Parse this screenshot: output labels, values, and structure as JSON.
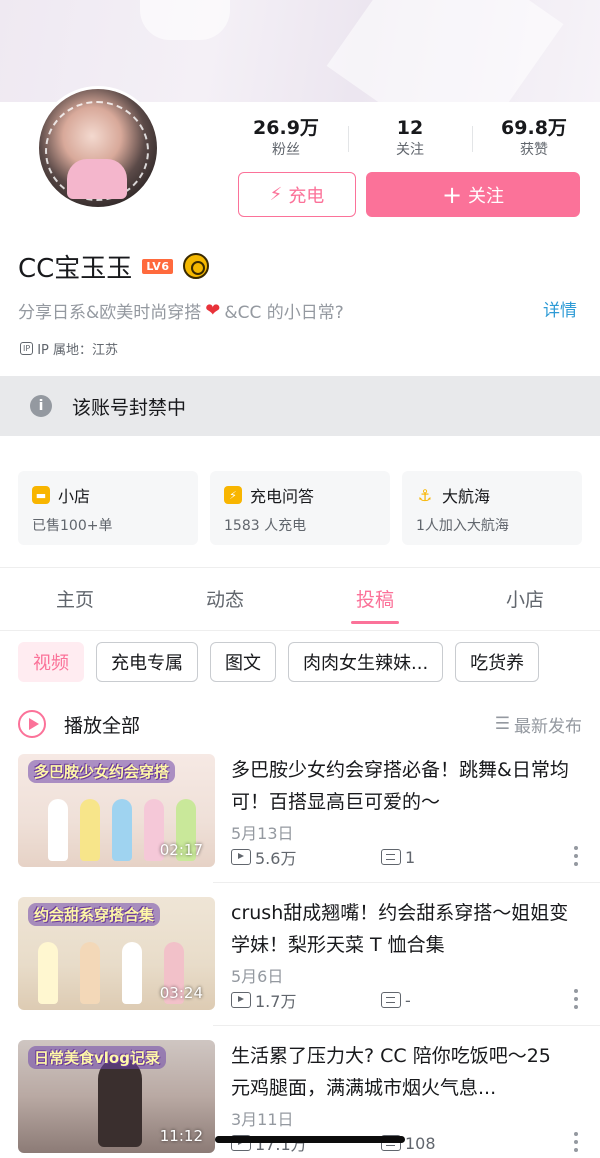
{
  "profile": {
    "name": "CC宝玉玉",
    "level": "LV6",
    "bio_prefix": "分享日系&欧美时尚穿搭",
    "bio_suffix": "&CC 的小日常?",
    "heart": "❤",
    "detail_link": "详情",
    "ip_label": "IP",
    "ip_text": "IP 属地：江苏"
  },
  "stats": [
    {
      "value": "26.9万",
      "label": "粉丝"
    },
    {
      "value": "12",
      "label": "关注"
    },
    {
      "value": "69.8万",
      "label": "获赞"
    }
  ],
  "actions": {
    "charge_label": "充电",
    "charge_icon": "⚡",
    "follow_label": "关注",
    "follow_icon": "+"
  },
  "notice": {
    "icon": "i",
    "text": "该账号封禁中"
  },
  "cards": [
    {
      "title": "小店",
      "sub": "已售100+单",
      "icon": "shop-icon",
      "color": "#f8b500"
    },
    {
      "title": "充电问答",
      "sub": "1583 人充电",
      "icon": "lightning-icon",
      "color": "#f8b500"
    },
    {
      "title": "大航海",
      "sub": "1人加入大航海",
      "icon": "anchor-icon",
      "color": "#f8b500"
    }
  ],
  "tabs": [
    {
      "label": "主页",
      "active": false
    },
    {
      "label": "动态",
      "active": false
    },
    {
      "label": "投稿",
      "active": true
    },
    {
      "label": "小店",
      "active": false
    }
  ],
  "chips": [
    "视频",
    "充电专属",
    "图文",
    "肉肉女生辣妹...",
    "吃货养"
  ],
  "list_header": {
    "play_all": "播放全部",
    "sort": "最新发布",
    "sort_icon": "☰"
  },
  "videos": [
    {
      "thumb_tag": "多巴胺少女约会穿搭",
      "duration": "02:17",
      "title": "多巴胺少女约会穿搭必备！跳舞&日常均可！百搭显高巨可爱的～",
      "date": "5月13日",
      "views": "5.6万",
      "comments": "1"
    },
    {
      "thumb_tag": "约会甜系穿搭合集",
      "duration": "03:24",
      "title": "crush甜成翘嘴！约会甜系穿搭～姐姐变学妹！梨形天菜 T 恤合集",
      "date": "5月6日",
      "views": "1.7万",
      "comments": "-"
    },
    {
      "thumb_tag": "日常美食vlog记录",
      "duration": "11:12",
      "title": "生活累了压力大? CC 陪你吃饭吧～25 元鸡腿面，满满城市烟火气息...",
      "date": "3月11日",
      "views": "17.1万",
      "comments": "108"
    }
  ],
  "colors": {
    "accent": "#fb7299",
    "link": "#2e9bd6",
    "banner_gray": "#e8e9eb"
  }
}
